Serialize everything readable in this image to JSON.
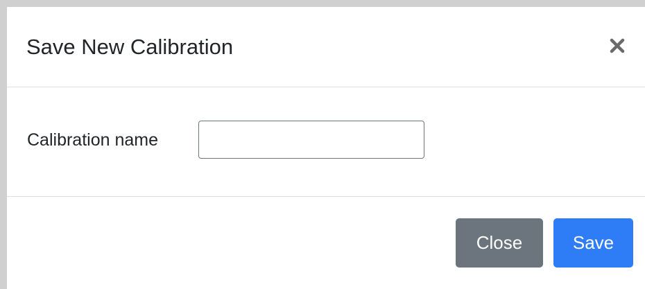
{
  "modal": {
    "title": "Save New Calibration",
    "close_icon": "close-icon"
  },
  "form": {
    "label": "Calibration name",
    "input_value": "",
    "input_placeholder": ""
  },
  "footer": {
    "close_label": "Close",
    "save_label": "Save"
  },
  "colors": {
    "close_button": "#6c757d",
    "save_button": "#2f7df6"
  }
}
